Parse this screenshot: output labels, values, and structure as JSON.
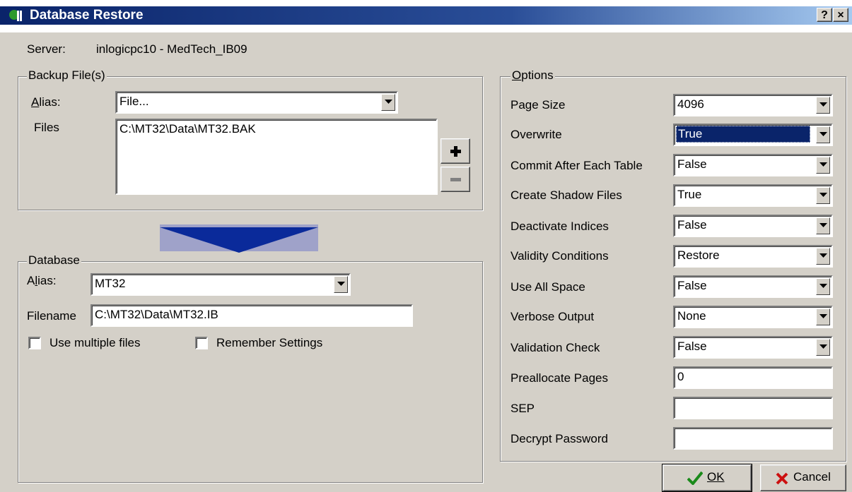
{
  "window": {
    "title": "Database Restore",
    "help_label": "?",
    "close_label": "×"
  },
  "server": {
    "label": "Server:",
    "value": "inlogicpc10 - MedTech_IB09"
  },
  "backup": {
    "legend": "Backup File(s)",
    "alias_label": "Alias:",
    "alias_value": "File...",
    "files_label": "Files",
    "files": [
      "C:\\MT32\\Data\\MT32.BAK"
    ],
    "add_label": "+",
    "remove_label": "−"
  },
  "database": {
    "legend": "Database",
    "alias_label": "Alias:",
    "alias_value": "MT32",
    "filename_label": "Filename",
    "filename_value": "C:\\MT32\\Data\\MT32.IB",
    "use_multiple_label": "Use multiple files",
    "remember_label": "Remember Settings"
  },
  "options": {
    "legend": "Options",
    "rows": [
      {
        "label": "Page Size",
        "value": "4096"
      },
      {
        "label": "Overwrite",
        "value": "True"
      },
      {
        "label": "Commit After Each Table",
        "value": "False"
      },
      {
        "label": "Create Shadow Files",
        "value": "True"
      },
      {
        "label": "Deactivate Indices",
        "value": "False"
      },
      {
        "label": "Validity Conditions",
        "value": "Restore"
      },
      {
        "label": "Use All Space",
        "value": "False"
      },
      {
        "label": "Verbose Output",
        "value": "None"
      },
      {
        "label": "Validation Check",
        "value": "False"
      },
      {
        "label": "Preallocate Pages",
        "value": "0"
      },
      {
        "label": "SEP",
        "value": ""
      },
      {
        "label": "Decrypt Password",
        "value": ""
      }
    ]
  },
  "buttons": {
    "ok_label": "OK",
    "cancel_label": "Cancel"
  },
  "colors": {
    "title_bar": "#0a246a",
    "selection": "#0a246a",
    "face": "#d4d0c8",
    "arrow": "#0a2a9a"
  }
}
